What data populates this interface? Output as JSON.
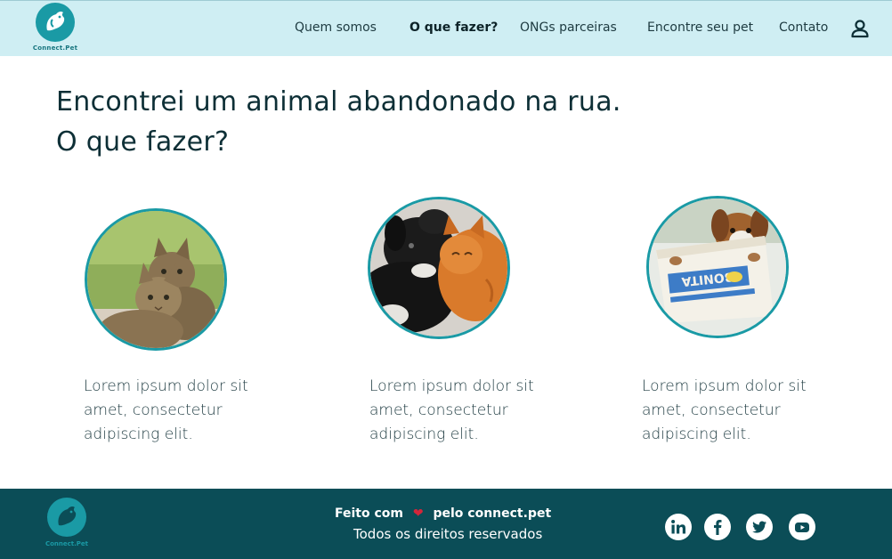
{
  "header": {
    "logo_text": "Connect.Pet",
    "nav": [
      {
        "label": "Quem somos"
      },
      {
        "label": "O que fazer?"
      },
      {
        "label": "ONGs parceiras"
      },
      {
        "label": "Encontre seu pet"
      },
      {
        "label": "Contato"
      }
    ],
    "user_icon": "user-icon"
  },
  "main": {
    "heading_line1": "Encontrei um animal abandonado na rua.",
    "heading_line2": "O que fazer?",
    "cards": [
      {
        "image": "two-kittens",
        "text": "Lorem ipsum dolor sit amet, consectetur adipiscing elit."
      },
      {
        "image": "dog-and-cat",
        "text": "Lorem ipsum dolor sit amet, consectetur adipiscing elit."
      },
      {
        "image": "dog-in-box",
        "text": "Lorem ipsum dolor sit amet, consectetur adipiscing elit."
      }
    ]
  },
  "footer": {
    "logo_text": "Connect.Pet",
    "made_with_prefix": "Feito com",
    "made_with_suffix": "pelo connect.pet",
    "rights": "Todos os direitos reservados",
    "social": [
      "linkedin-icon",
      "facebook-icon",
      "twitter-icon",
      "youtube-icon"
    ]
  },
  "colors": {
    "header_bg": "#cfeef3",
    "accent": "#1a9aa5",
    "footer_bg": "#0b4d57",
    "heart": "#d4263a"
  }
}
